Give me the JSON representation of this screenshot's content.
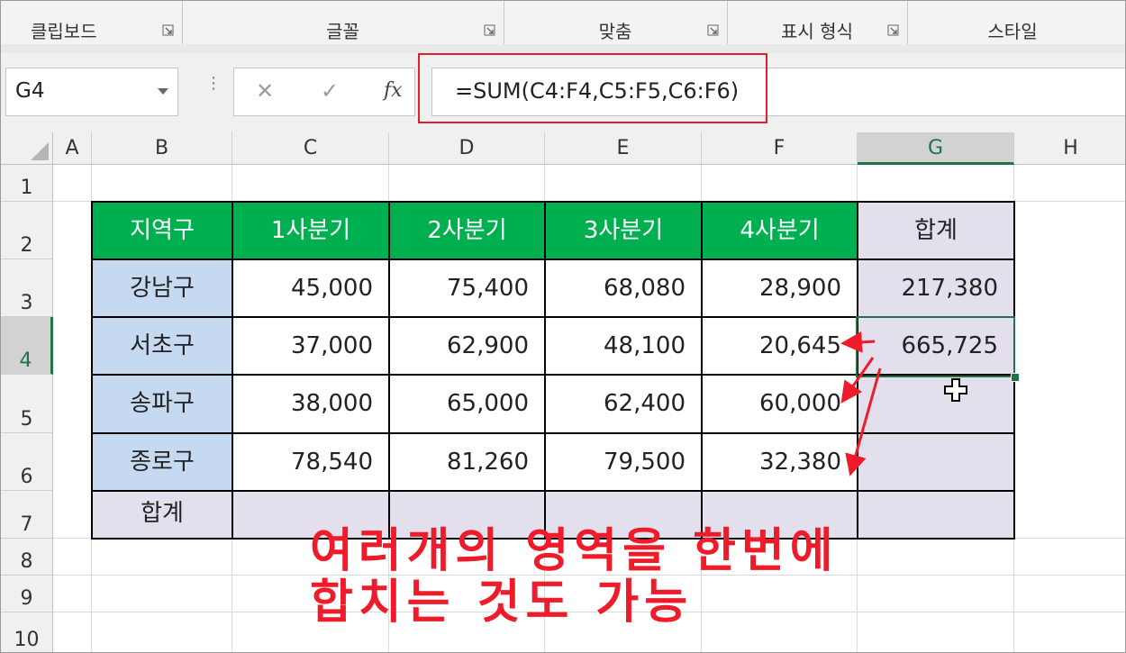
{
  "ribbon": {
    "groups": [
      "클립보드",
      "글꼴",
      "맞춤",
      "표시 형식",
      "스타일"
    ]
  },
  "formula_bar": {
    "name_box": "G4",
    "cancel_glyph": "✕",
    "enter_glyph": "✓",
    "fx_label": "fx",
    "formula": "=SUM(C4:F4,C5:F5,C6:F6)"
  },
  "columns": [
    "A",
    "B",
    "C",
    "D",
    "E",
    "F",
    "G",
    "H"
  ],
  "rows": [
    "1",
    "2",
    "3",
    "4",
    "5",
    "6",
    "7",
    "8",
    "9",
    "10"
  ],
  "selected_cell": "G4",
  "table": {
    "headers": [
      "지역구",
      "1사분기",
      "2사분기",
      "3사분기",
      "4사분기",
      "합계"
    ],
    "rows": [
      {
        "region": "강남구",
        "values": [
          "45,000",
          "75,400",
          "68,080",
          "28,900"
        ],
        "total": "217,380"
      },
      {
        "region": "서초구",
        "values": [
          "37,000",
          "62,900",
          "48,100",
          "20,645"
        ],
        "total": "665,725"
      },
      {
        "region": "송파구",
        "values": [
          "38,000",
          "65,000",
          "62,400",
          "60,000"
        ],
        "total": ""
      },
      {
        "region": "종로구",
        "values": [
          "78,540",
          "81,260",
          "79,500",
          "32,380"
        ],
        "total": ""
      }
    ],
    "total_row_label": "합계"
  },
  "annotation": {
    "line1": "여러개의 영역을 한번에",
    "line2": "합치는 것도 가능"
  },
  "colors": {
    "header_green": "#00b050",
    "region_blue": "#c5d9f1",
    "total_lavender": "#e4dfec",
    "annotation_red": "#ee1c2a",
    "selection_green": "#217346"
  }
}
